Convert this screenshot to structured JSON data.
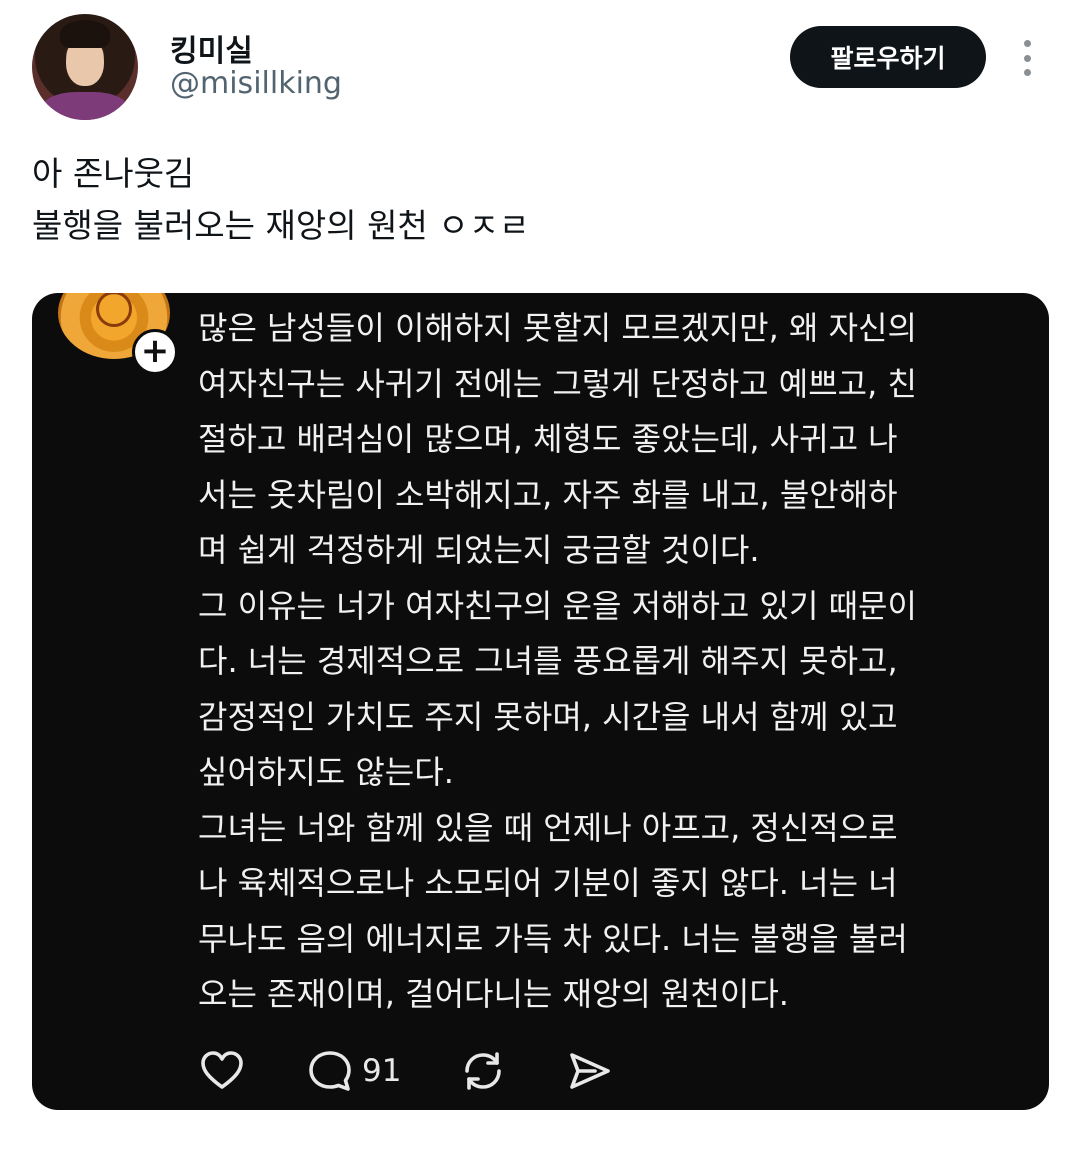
{
  "header": {
    "display_name": "킹미실",
    "handle": "@misillking",
    "follow_label": "팔로우하기"
  },
  "tweet": {
    "lines": [
      "아 존나웃김",
      "불행을 불러오는 재앙의 원천 ㅇㅈㄹ"
    ]
  },
  "embedded_post": {
    "paragraphs": [
      [
        "많은 남성들이 이해하지 못할지 모르겠지만, 왜 자신의",
        "여자친구는 사귀기 전에는 그렇게 단정하고 예쁘고, 친",
        "절하고 배려심이 많으며, 체형도 좋았는데, 사귀고 나",
        "서는 옷차림이 소박해지고, 자주 화를 내고, 불안해하",
        "며 쉽게 걱정하게 되었는지 궁금할 것이다."
      ],
      [
        "그 이유는 너가 여자친구의 운을 저해하고 있기 때문이",
        "다. 너는 경제적으로 그녀를 풍요롭게 해주지 못하고,",
        "감정적인 가치도 주지 못하며, 시간을 내서 함께 있고",
        "싶어하지도 않는다."
      ],
      [
        "그녀는 너와 함께 있을 때 언제나 아프고, 정신적으로",
        "나 육체적으로나 소모되어 기분이 좋지 않다. 너는 너",
        "무나도 음의 에너지로 가득 차 있다. 너는 불행을 불러",
        "오는 존재이며, 걸어다니는 재앙의 원천이다."
      ]
    ],
    "plus_badge": "+",
    "reply_count": "91"
  },
  "icons": {
    "like": "heart-icon",
    "reply": "speech-bubble-icon",
    "repost": "repost-icon",
    "share": "send-icon",
    "more": "more-vertical-icon"
  }
}
